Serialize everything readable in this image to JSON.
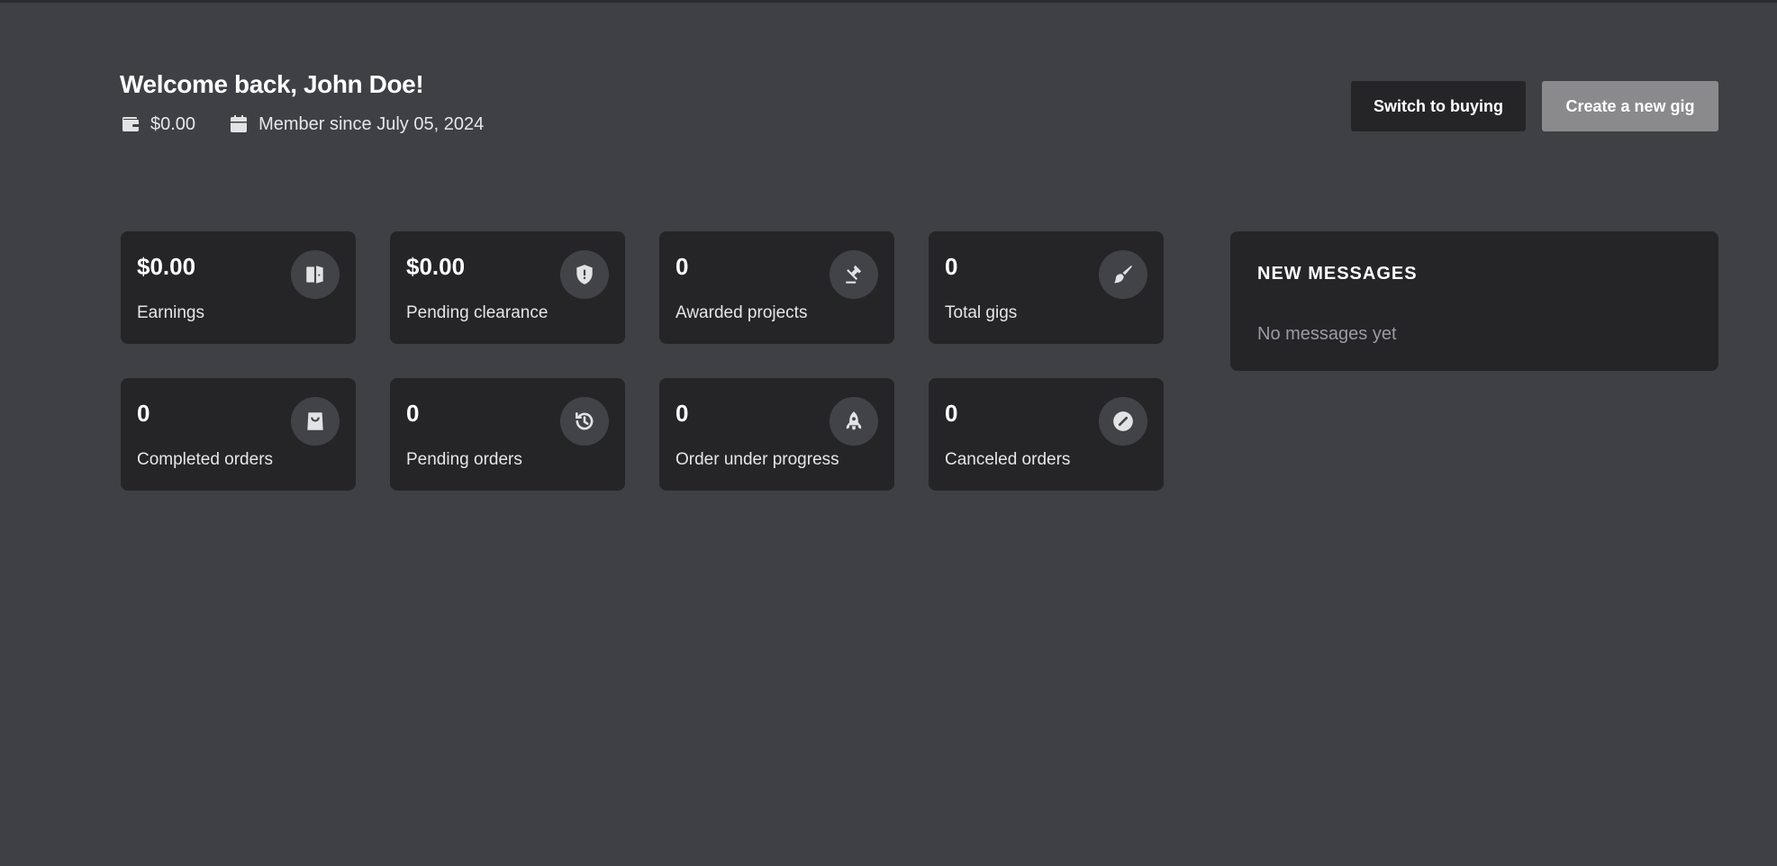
{
  "header": {
    "welcome": "Welcome back, John Doe!",
    "balance": "$0.00",
    "balance_icon": "wallet-icon",
    "member_since": "Member since July 05, 2024",
    "member_icon": "calendar-icon"
  },
  "actions": {
    "switch_label": "Switch to buying",
    "create_label": "Create a new gig"
  },
  "stats": [
    {
      "value": "$0.00",
      "label": "Earnings",
      "icon": "vault-icon"
    },
    {
      "value": "$0.00",
      "label": "Pending clearance",
      "icon": "shield-alert-icon"
    },
    {
      "value": "0",
      "label": "Awarded projects",
      "icon": "gavel-icon"
    },
    {
      "value": "0",
      "label": "Total gigs",
      "icon": "paintbrush-icon"
    },
    {
      "value": "0",
      "label": "Completed orders",
      "icon": "shopping-bag-icon"
    },
    {
      "value": "0",
      "label": "Pending orders",
      "icon": "history-icon"
    },
    {
      "value": "0",
      "label": "Order under progress",
      "icon": "rocket-icon"
    },
    {
      "value": "0",
      "label": "Canceled orders",
      "icon": "cancel-icon"
    }
  ],
  "messages": {
    "title": "NEW MESSAGES",
    "empty_text": "No messages yet"
  },
  "colors": {
    "background": "#3f4046",
    "card": "#252528",
    "icon_circle": "#424349",
    "primary_button": "#8a8a8d",
    "muted_text": "#9a9ca3"
  }
}
